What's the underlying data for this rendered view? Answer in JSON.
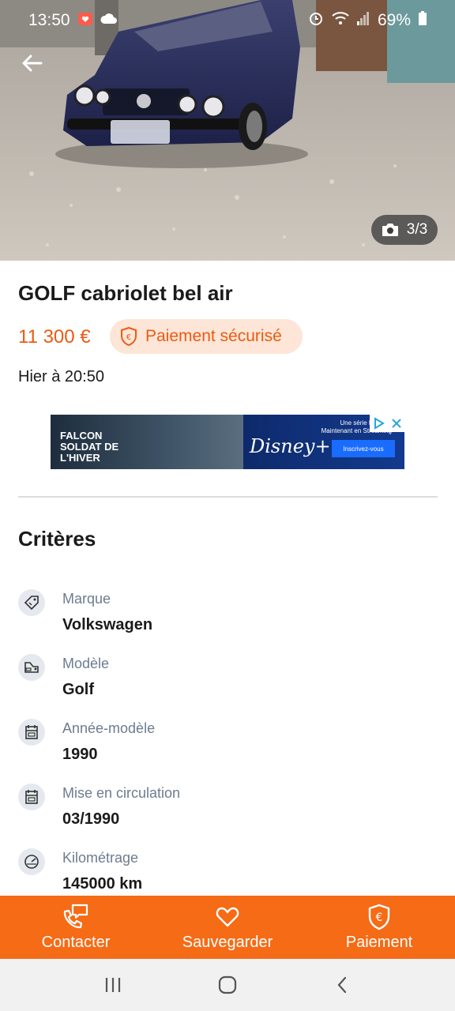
{
  "status_bar": {
    "time": "13:50",
    "battery": "69%"
  },
  "photo": {
    "counter": "3/3"
  },
  "listing": {
    "title": "GOLF cabriolet bel air",
    "price": "11 300 €",
    "secure_badge": "Paiement sécurisé",
    "date": "Hier à 20:50"
  },
  "ad": {
    "title_line1": "FALCON",
    "title_line2": "SOLDAT DE L'HIVER",
    "brand": "Disney+",
    "tagline": "Une série Disney+ Maintenant en Streaming",
    "cta": "Inscrivez-vous"
  },
  "criteria": {
    "title": "Critères",
    "items": [
      {
        "label": "Marque",
        "value": "Volkswagen",
        "icon": "tag-icon"
      },
      {
        "label": "Modèle",
        "value": "Golf",
        "icon": "car-model-icon"
      },
      {
        "label": "Année-modèle",
        "value": "1990",
        "icon": "calendar-icon"
      },
      {
        "label": "Mise en circulation",
        "value": "03/1990",
        "icon": "calendar-icon"
      },
      {
        "label": "Kilométrage",
        "value": "145000 km",
        "icon": "speedometer-icon"
      }
    ]
  },
  "actions": {
    "contact": "Contacter",
    "save": "Sauvegarder",
    "payment": "Paiement"
  },
  "colors": {
    "accent": "#f56b16",
    "price": "#ec5a13",
    "badge_bg": "#fde6d7",
    "label_gray": "#6d7c8f"
  }
}
